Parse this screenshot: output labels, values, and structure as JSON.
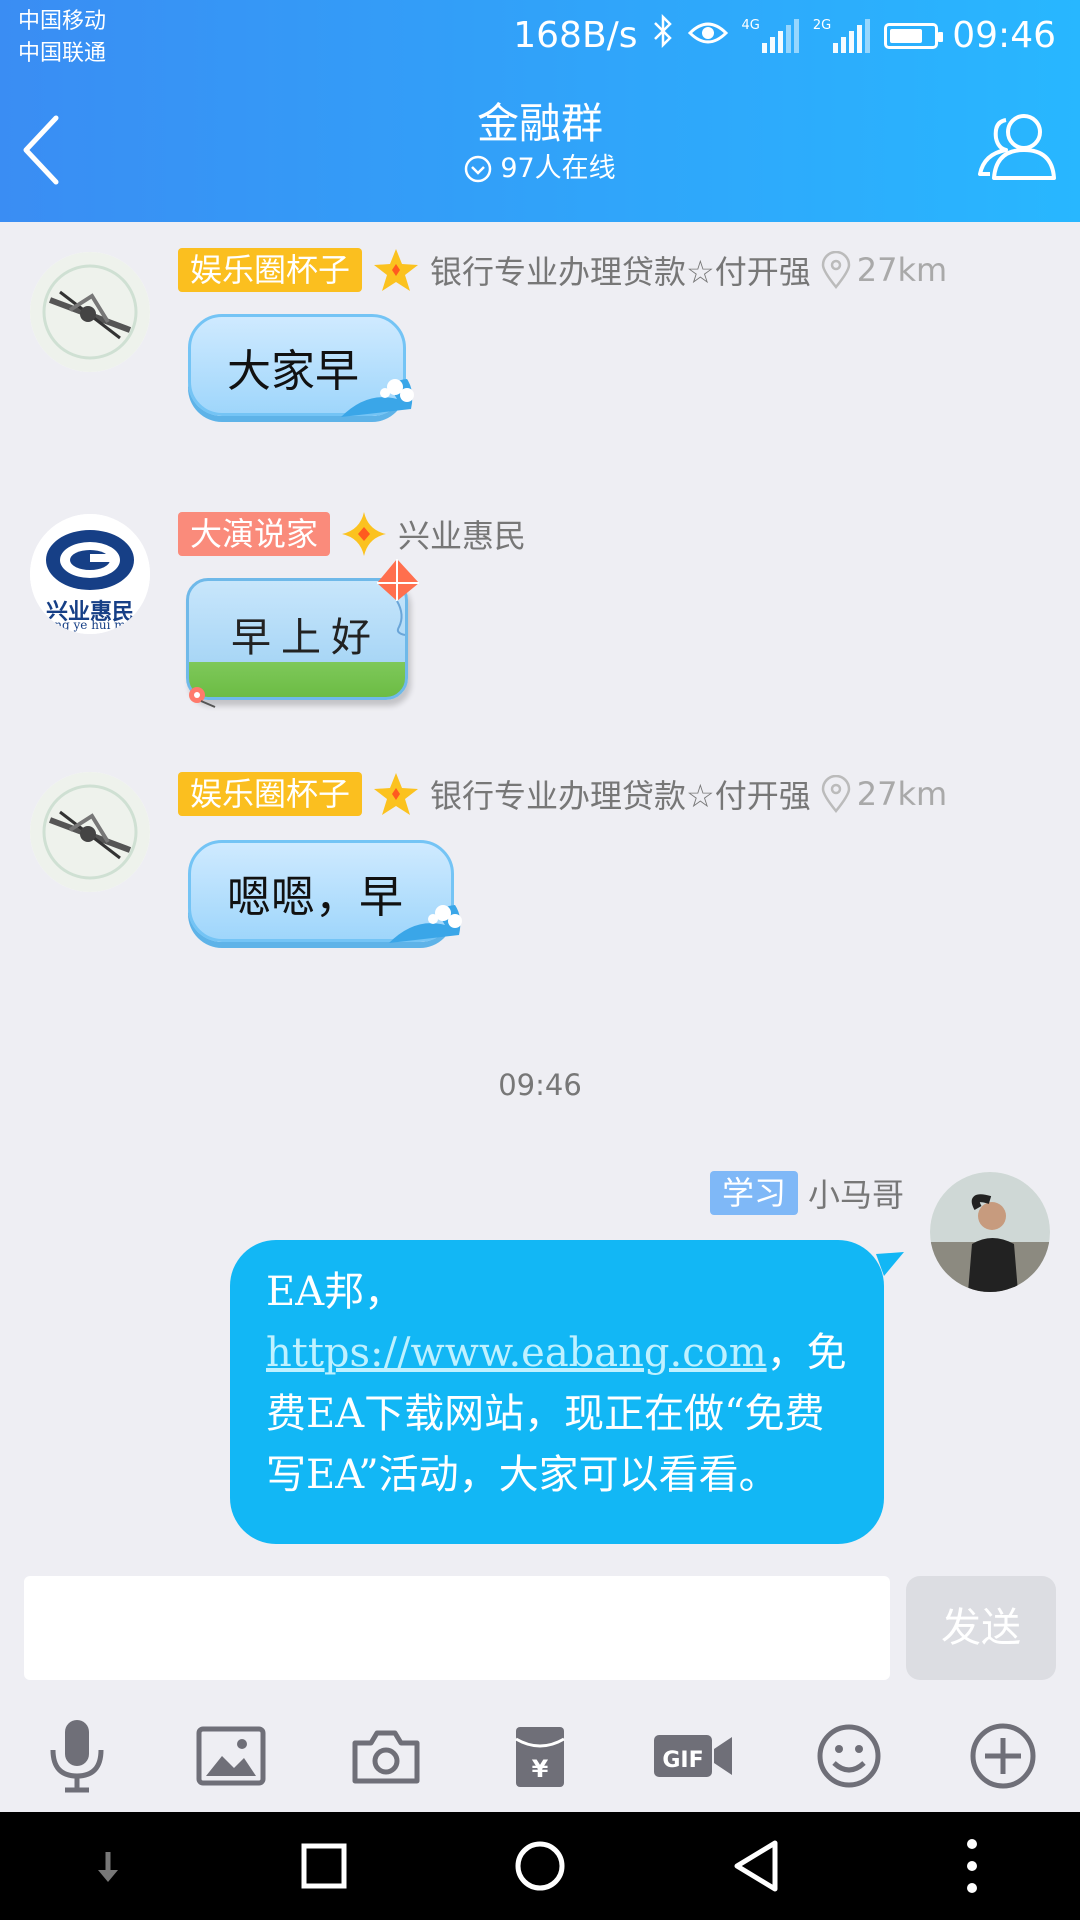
{
  "status_bar": {
    "carrier1": "中国移动",
    "carrier2": "中国联通",
    "speed": "168B/s",
    "net1": "4G",
    "net2": "2G",
    "time": "09:46",
    "battery_level": 0.8
  },
  "header": {
    "title": "金融群",
    "online": "97人在线"
  },
  "messages": [
    {
      "badge": "娱乐圈杯子",
      "badge_color": "#fbbf1f",
      "sender": "银行专业办理贷款☆付开强",
      "distance": "27km",
      "text": "大家早"
    },
    {
      "badge": "大演说家",
      "badge_color": "#fa8b7b",
      "sender": "兴业惠民",
      "text": "早上好",
      "avatar_text": "兴业惠民",
      "avatar_subtext": "ng ye hui m"
    },
    {
      "badge": "娱乐圈杯子",
      "badge_color": "#fbbf1f",
      "sender": "银行专业办理贷款☆付开强",
      "distance": "27km",
      "text": "嗯嗯，早"
    }
  ],
  "time_separator": "09:46",
  "own_message": {
    "badge": "学习",
    "sender": "小马哥",
    "text_before": "EA邦，",
    "link": "https://www.eabang.com",
    "text_after": "，免费EA下载网站，现正在做“免费写EA”活动，大家可以看看。"
  },
  "input": {
    "placeholder": "",
    "send_label": "发送"
  },
  "toolbar_icons": [
    "mic-icon",
    "image-icon",
    "camera-icon",
    "red-packet-icon",
    "gif-icon",
    "emoji-icon",
    "plus-icon"
  ],
  "colors": {
    "header_start": "#3a8df3",
    "header_end": "#28b7ff",
    "own_bubble": "#12b7f5"
  }
}
